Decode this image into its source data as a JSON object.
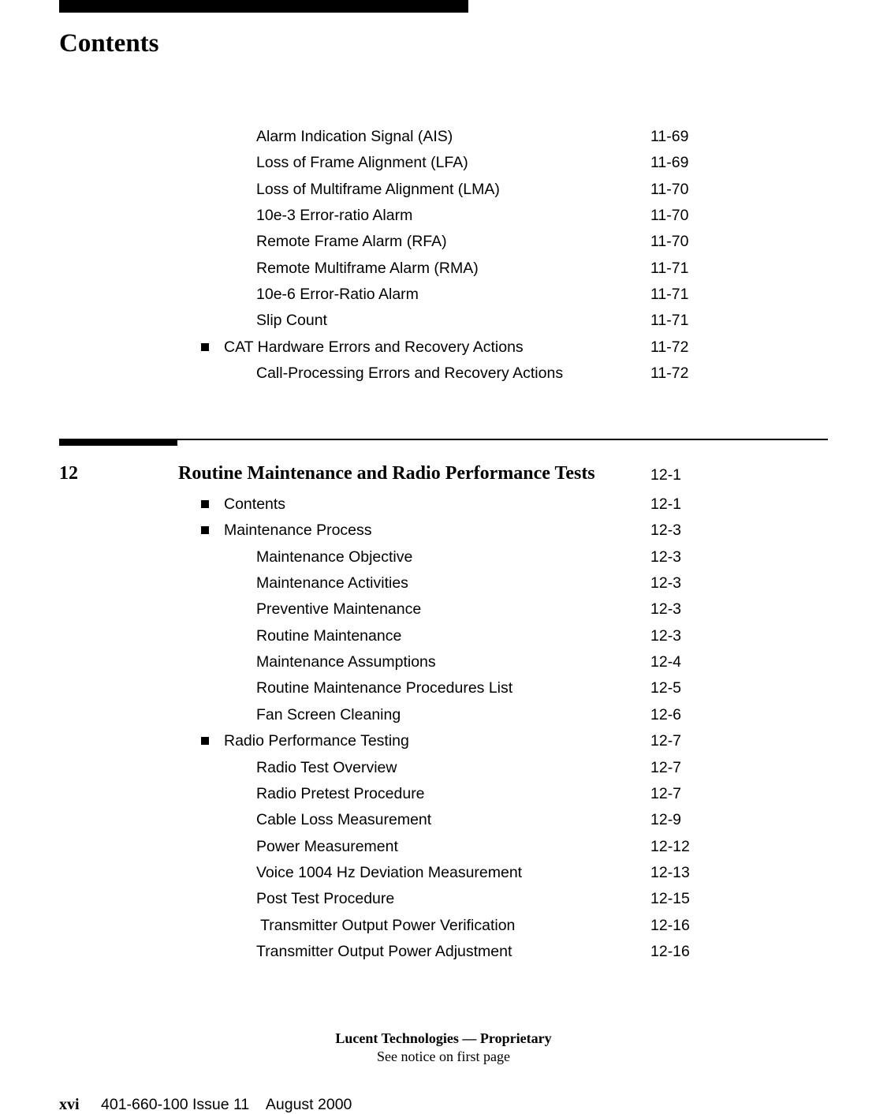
{
  "header": {
    "title": "Contents"
  },
  "section_11_continued": [
    {
      "level": 2,
      "label": "Alarm Indication Signal (AIS)",
      "page": "11-69"
    },
    {
      "level": 2,
      "label": "Loss of Frame Alignment (LFA)",
      "page": "11-69"
    },
    {
      "level": 2,
      "label": "Loss of Multiframe Alignment (LMA)",
      "page": "11-70"
    },
    {
      "level": 2,
      "label": "10e-3 Error-ratio Alarm",
      "page": "11-70"
    },
    {
      "level": 2,
      "label": "Remote Frame Alarm (RFA)",
      "page": "11-70"
    },
    {
      "level": 2,
      "label": "Remote Multiframe Alarm (RMA)",
      "page": "11-71"
    },
    {
      "level": 2,
      "label": "10e-6 Error-Ratio Alarm",
      "page": "11-71"
    },
    {
      "level": 2,
      "label": "Slip Count",
      "page": "11-71"
    },
    {
      "level": 1,
      "label": "CAT Hardware Errors and Recovery Actions",
      "page": "11-72"
    },
    {
      "level": 2,
      "label": "Call-Processing Errors and Recovery Actions",
      "page": "11-72"
    }
  ],
  "chapter_12": {
    "number": "12",
    "title": "Routine Maintenance and Radio Performance Tests",
    "page": "12-1",
    "entries": [
      {
        "level": 1,
        "label": "Contents",
        "page": "12-1"
      },
      {
        "level": 1,
        "label": "Maintenance Process",
        "page": "12-3"
      },
      {
        "level": 2,
        "label": "Maintenance Objective",
        "page": "12-3"
      },
      {
        "level": 2,
        "label": "Maintenance Activities",
        "page": "12-3"
      },
      {
        "level": 2,
        "label": "Preventive Maintenance",
        "page": "12-3"
      },
      {
        "level": 2,
        "label": "Routine Maintenance",
        "page": "12-3"
      },
      {
        "level": 2,
        "label": "Maintenance Assumptions",
        "page": "12-4"
      },
      {
        "level": 2,
        "label": "Routine Maintenance Procedures List",
        "page": "12-5"
      },
      {
        "level": 2,
        "label": "Fan Screen Cleaning",
        "page": "12-6"
      },
      {
        "level": 1,
        "label": "Radio Performance Testing",
        "page": "12-7"
      },
      {
        "level": 2,
        "label": "Radio Test Overview",
        "page": "12-7"
      },
      {
        "level": 2,
        "label": "Radio Pretest Procedure",
        "page": "12-7"
      },
      {
        "level": 2,
        "label": "Cable Loss Measurement",
        "page": "12-9"
      },
      {
        "level": 2,
        "label": "Power Measurement",
        "page": "12-12"
      },
      {
        "level": 2,
        "label": "Voice 1004 Hz Deviation Measurement",
        "page": "12-13"
      },
      {
        "level": 2,
        "label": "Post Test Procedure",
        "page": "12-15"
      },
      {
        "level": 2,
        "label": " Transmitter Output Power Verification",
        "page": "12-16"
      },
      {
        "level": 2,
        "label": "Transmitter Output Power Adjustment",
        "page": "12-16"
      }
    ]
  },
  "footer": {
    "company": "Lucent Technologies — Proprietary",
    "notice": "See notice on first page",
    "folio": "xvi",
    "doc_id": "401-660-100 Issue 11    August 2000"
  }
}
